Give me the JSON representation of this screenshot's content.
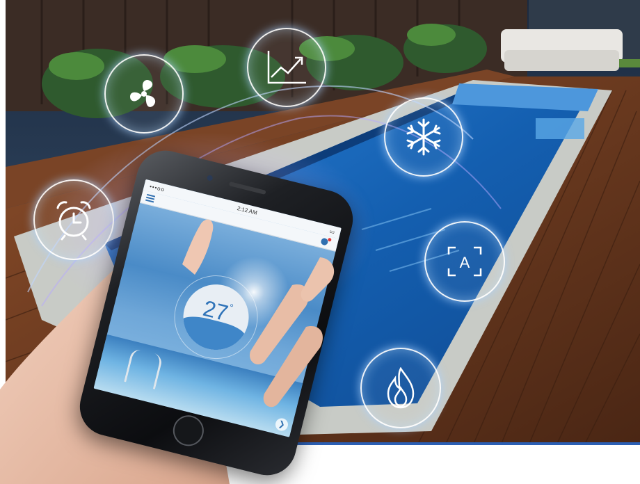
{
  "scene": {
    "description_free": true,
    "colors": {
      "sky": "#2c4a6e",
      "fence": "#3a2a22",
      "deck": "#6a3c22",
      "coping": "#c9ccc8",
      "pool": "#1f6fc0",
      "icon_glow": "#aad2ff"
    }
  },
  "features": [
    {
      "name": "fan",
      "icon": "fan-icon"
    },
    {
      "name": "chart",
      "icon": "chart-icon"
    },
    {
      "name": "snowflake",
      "icon": "snowflake-icon"
    },
    {
      "name": "alarm",
      "icon": "alarm-clock-icon"
    },
    {
      "name": "auto",
      "icon": "auto-mode-icon",
      "label": "A"
    },
    {
      "name": "flame",
      "icon": "flame-icon"
    }
  ],
  "phone": {
    "status_bar": {
      "carrier": "•••oo",
      "time": "2:12 AM"
    },
    "temperature": "27",
    "degree_symbol": "°",
    "chevron": "❯"
  }
}
